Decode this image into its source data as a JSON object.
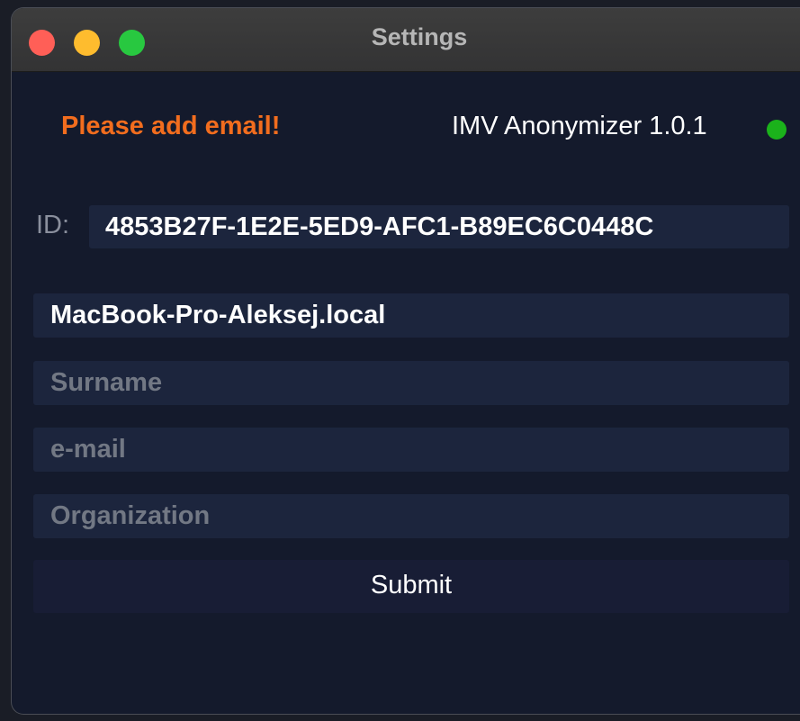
{
  "window": {
    "title": "Settings"
  },
  "header": {
    "warning": "Please add email!",
    "app_version": "IMV Anonymizer 1.0.1",
    "status_color": "#1bb21b"
  },
  "identity": {
    "id_label": "ID:",
    "id_value": "4853B27F-1E2E-5ED9-AFC1-B89EC6C0448C"
  },
  "form": {
    "hostname_value": "MacBook-Pro-Aleksej.local",
    "surname_placeholder": "Surname",
    "email_placeholder": "e-mail",
    "organization_placeholder": "Organization",
    "submit_label": "Submit"
  },
  "colors": {
    "warning": "#f26d1e",
    "background": "#141a2c",
    "field": "#1c253d"
  }
}
